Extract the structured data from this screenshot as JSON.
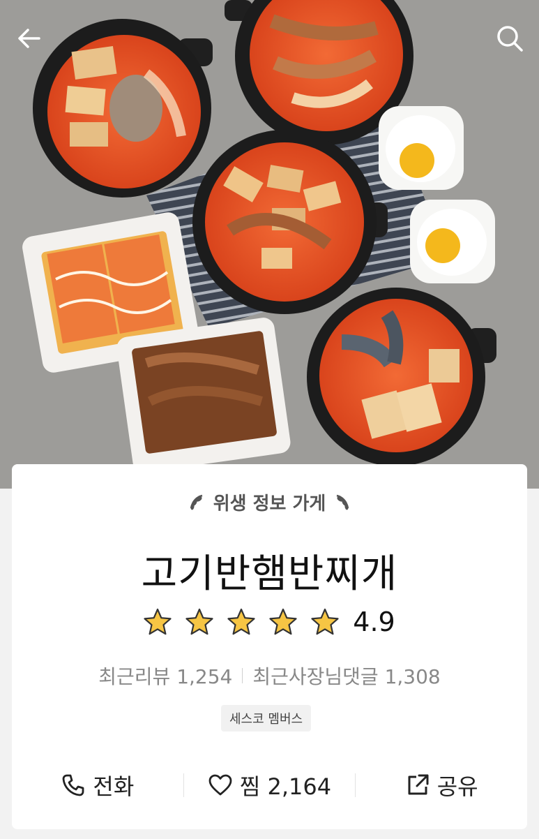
{
  "header": {
    "back_icon": "arrow-left-icon",
    "search_icon": "search-icon"
  },
  "store": {
    "hygiene_label": "위생 정보 가게",
    "name": "고기반햄반찌개",
    "rating": "4.9",
    "stars_filled": 5,
    "stars_total": 5,
    "recent_reviews": "최근리뷰 1,254",
    "recent_owner_replies": "최근사장님댓글 1,308",
    "badge": "세스코 멤버스"
  },
  "actions": {
    "call_label": "전화",
    "like_label": "찜 2,164",
    "share_label": "공유"
  },
  "colors": {
    "star": "#f6c544",
    "star_outline": "#333333",
    "text_primary": "#111111",
    "text_secondary": "#888888"
  }
}
